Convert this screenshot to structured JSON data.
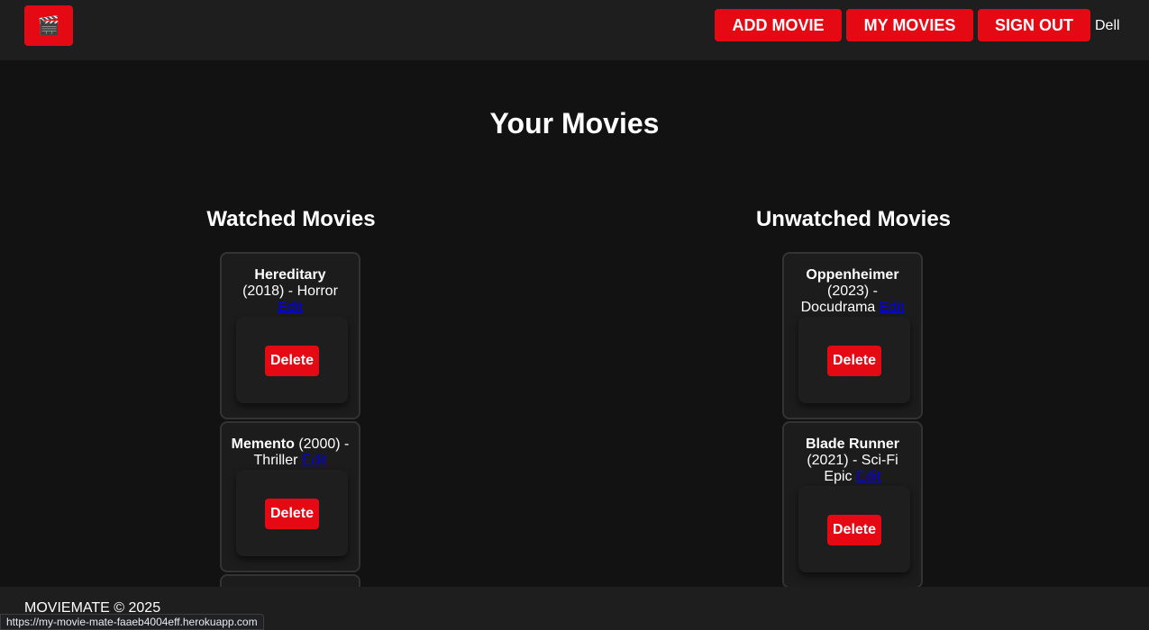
{
  "navbar": {
    "logo_icon": "clapperboard-icon",
    "logo_glyph": "🎬",
    "add_movie": "ADD MOVIE",
    "my_movies": "MY MOVIES",
    "sign_out": "SIGN OUT",
    "user": "Dell"
  },
  "main": {
    "title": "Your Movies",
    "watched": {
      "heading": "Watched Movies",
      "movies": [
        {
          "title": "Hereditary",
          "meta": "(2018) - Horror",
          "edit": "Edit",
          "delete": "Delete"
        },
        {
          "title": "Memento",
          "meta": "(2000) - Thriller",
          "edit": "Edit",
          "delete": "Delete"
        }
      ]
    },
    "unwatched": {
      "heading": "Unwatched Movies",
      "movies": [
        {
          "title": "Oppenheimer",
          "meta": "(2023) - Docudrama",
          "edit": "Edit",
          "delete": "Delete"
        },
        {
          "title": "Blade Runner",
          "meta": "(2021) - Sci-Fi Epic",
          "edit": "Edit",
          "delete": "Delete"
        }
      ]
    }
  },
  "footer": {
    "text": "MOVIEMATE © 2025"
  },
  "status_bar": {
    "url": "https://my-movie-mate-faaeb4004eff.herokuapp.com"
  },
  "colors": {
    "accent": "#e50914",
    "background": "#121212",
    "navbar": "#1e1e1e",
    "card": "#1c1c1c",
    "link": "#0000ee"
  }
}
